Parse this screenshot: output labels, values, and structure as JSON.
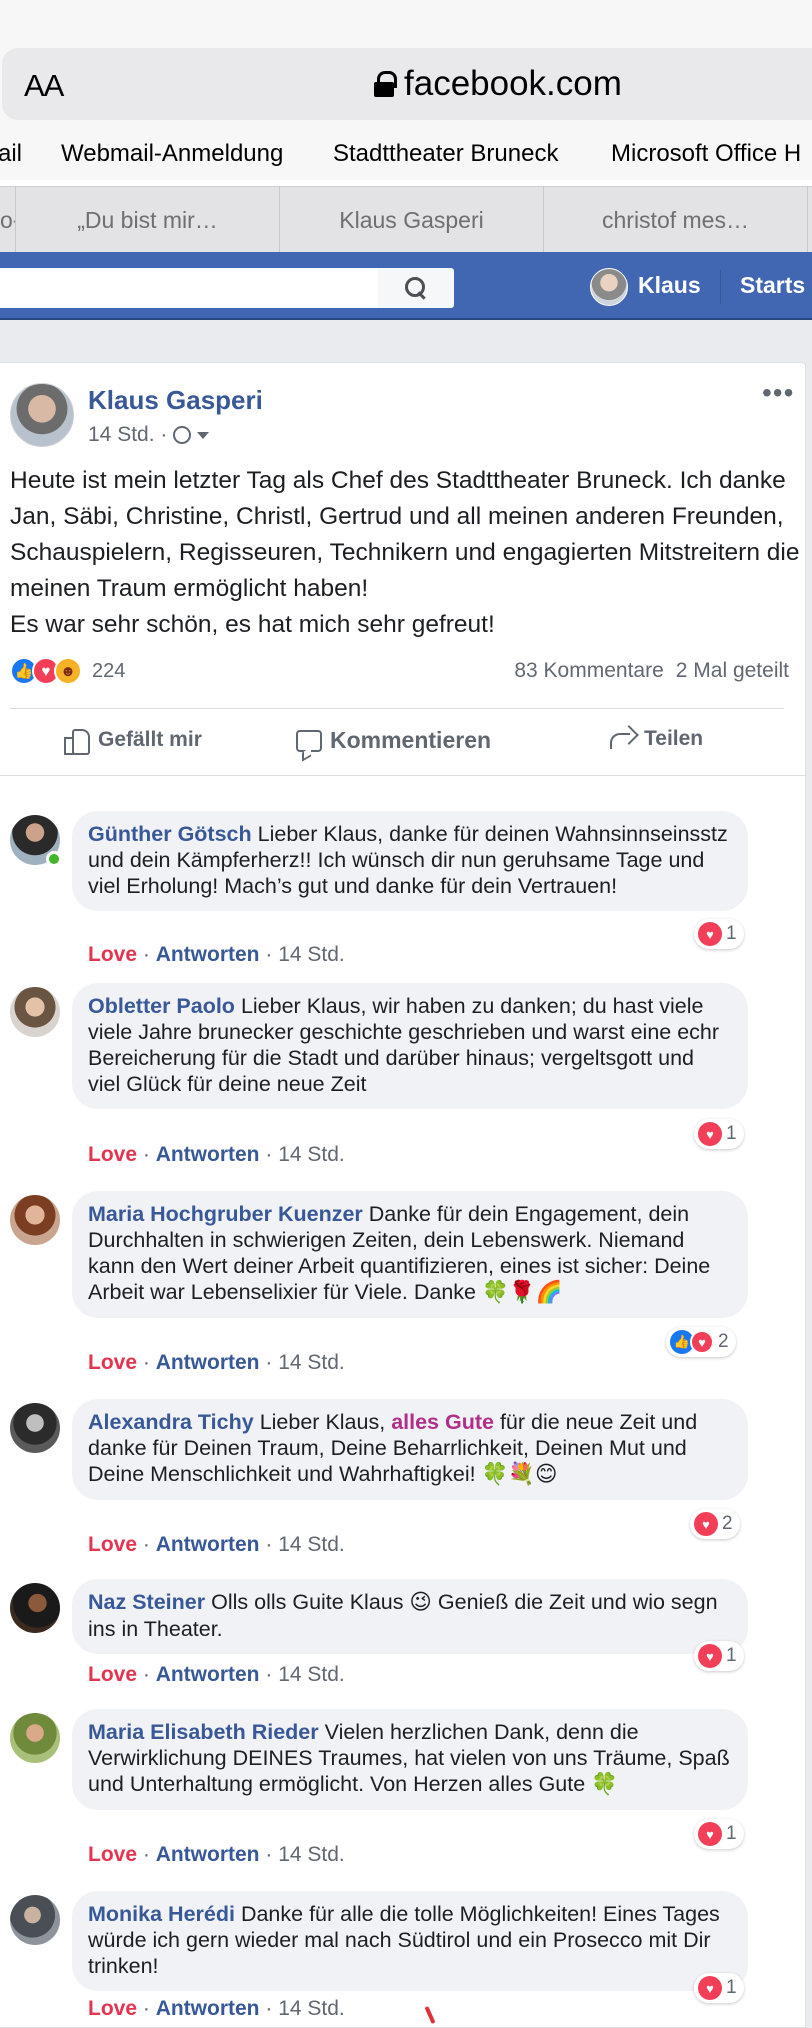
{
  "browser": {
    "text_size_button": "AA",
    "url": "facebook.com",
    "bookmarks": [
      "ail",
      "Webmail-Anmeldung",
      "Stadttheater Bruneck",
      "Microsoft Office H"
    ],
    "tabs": [
      "o-",
      "„Du bist mir…",
      "Klaus Gasperi",
      "christof mes…"
    ]
  },
  "header": {
    "user_name": "Klaus",
    "start_label": "Starts"
  },
  "post": {
    "author": "Klaus Gasperi",
    "time": "14 Std. ·",
    "text_line1": "Heute ist mein letzter Tag als Chef des Stadttheater Bruneck. Ich danke Jan, Säbi, Christine, Christl, Gertrud und all meinen anderen Freunden, Schauspielern, Regisseuren, Technikern und engagierten Mitstreitern die meinen Traum ermöglicht haben!",
    "text_line2": "Es war sehr schön, es hat mich sehr gefreut!",
    "reaction_count": "224",
    "comments_count": "83 Kommentare",
    "shares_count": "2 Mal geteilt",
    "more_icon": "•••"
  },
  "actions": {
    "like": "Gefällt mir",
    "comment": "Kommentieren",
    "share": "Teilen"
  },
  "comment_meta": {
    "love": "Love",
    "reply": "Antworten",
    "time": "14 Std."
  },
  "comments": [
    {
      "name": "Günther Götsch",
      "text": "Lieber Klaus, danke für deinen Wahnsinnseinsstz und dein Kämpferherz!! Ich wünsch dir nun geruhsame Tage und viel Erholung! Mach’s gut und danke für dein Vertrauen!",
      "reactions": "1"
    },
    {
      "name": "Obletter Paolo",
      "text": "Lieber Klaus, wir haben zu danken; du hast viele viele Jahre brunecker geschichte geschrieben und warst eine echr Bereicherung für die Stadt und darüber hinaus; vergeltsgott und viel Glück für deine neue Zeit",
      "reactions": "1"
    },
    {
      "name": "Maria Hochgruber Kuenzer",
      "text": "Danke für dein Engagement, dein Durchhalten in schwierigen Zeiten, dein Lebenswerk. Niemand kann den Wert deiner Arbeit quantifizieren, eines ist sicher: Deine Arbeit war Lebenselixier für Viele. Danke",
      "emoji": "🍀🌹🌈",
      "reactions": "2"
    },
    {
      "name": "Alexandra Tichy",
      "text_before": "Lieber Klaus,",
      "highlight": "alles Gute",
      "text_after": "für die neue Zeit und danke für Deinen Traum, Deine Beharrlichkeit, Deinen Mut und Deine Menschlichkeit und Wahrhaftigkei!",
      "emoji": "🍀💐😊",
      "reactions": "2"
    },
    {
      "name": "Naz Steiner",
      "text_before": "Olls olls Guite Klaus",
      "emoji": "😉",
      "text_after": "Genieß die Zeit und wio segn ins in Theater.",
      "reactions": "1"
    },
    {
      "name": "Maria Elisabeth Rieder",
      "text": "Vielen herzlichen Dank, denn die Verwirklichung DEINES Traumes, hat vielen von uns Träume, Spaß und Unterhaltung ermöglicht. Von Herzen alles Gute",
      "emoji": "🍀",
      "reactions": "1"
    },
    {
      "name": "Monika Herédi",
      "text": "Danke für alle die tolle Möglichkeiten! Eines Tages würde ich gern wieder mal nach Südtirol und ein Prosecco mit Dir trinken!",
      "reactions": "1"
    }
  ],
  "colors": {
    "fb_blue": "#4267b2",
    "link_blue": "#385898",
    "love_red": "#e4344f"
  }
}
